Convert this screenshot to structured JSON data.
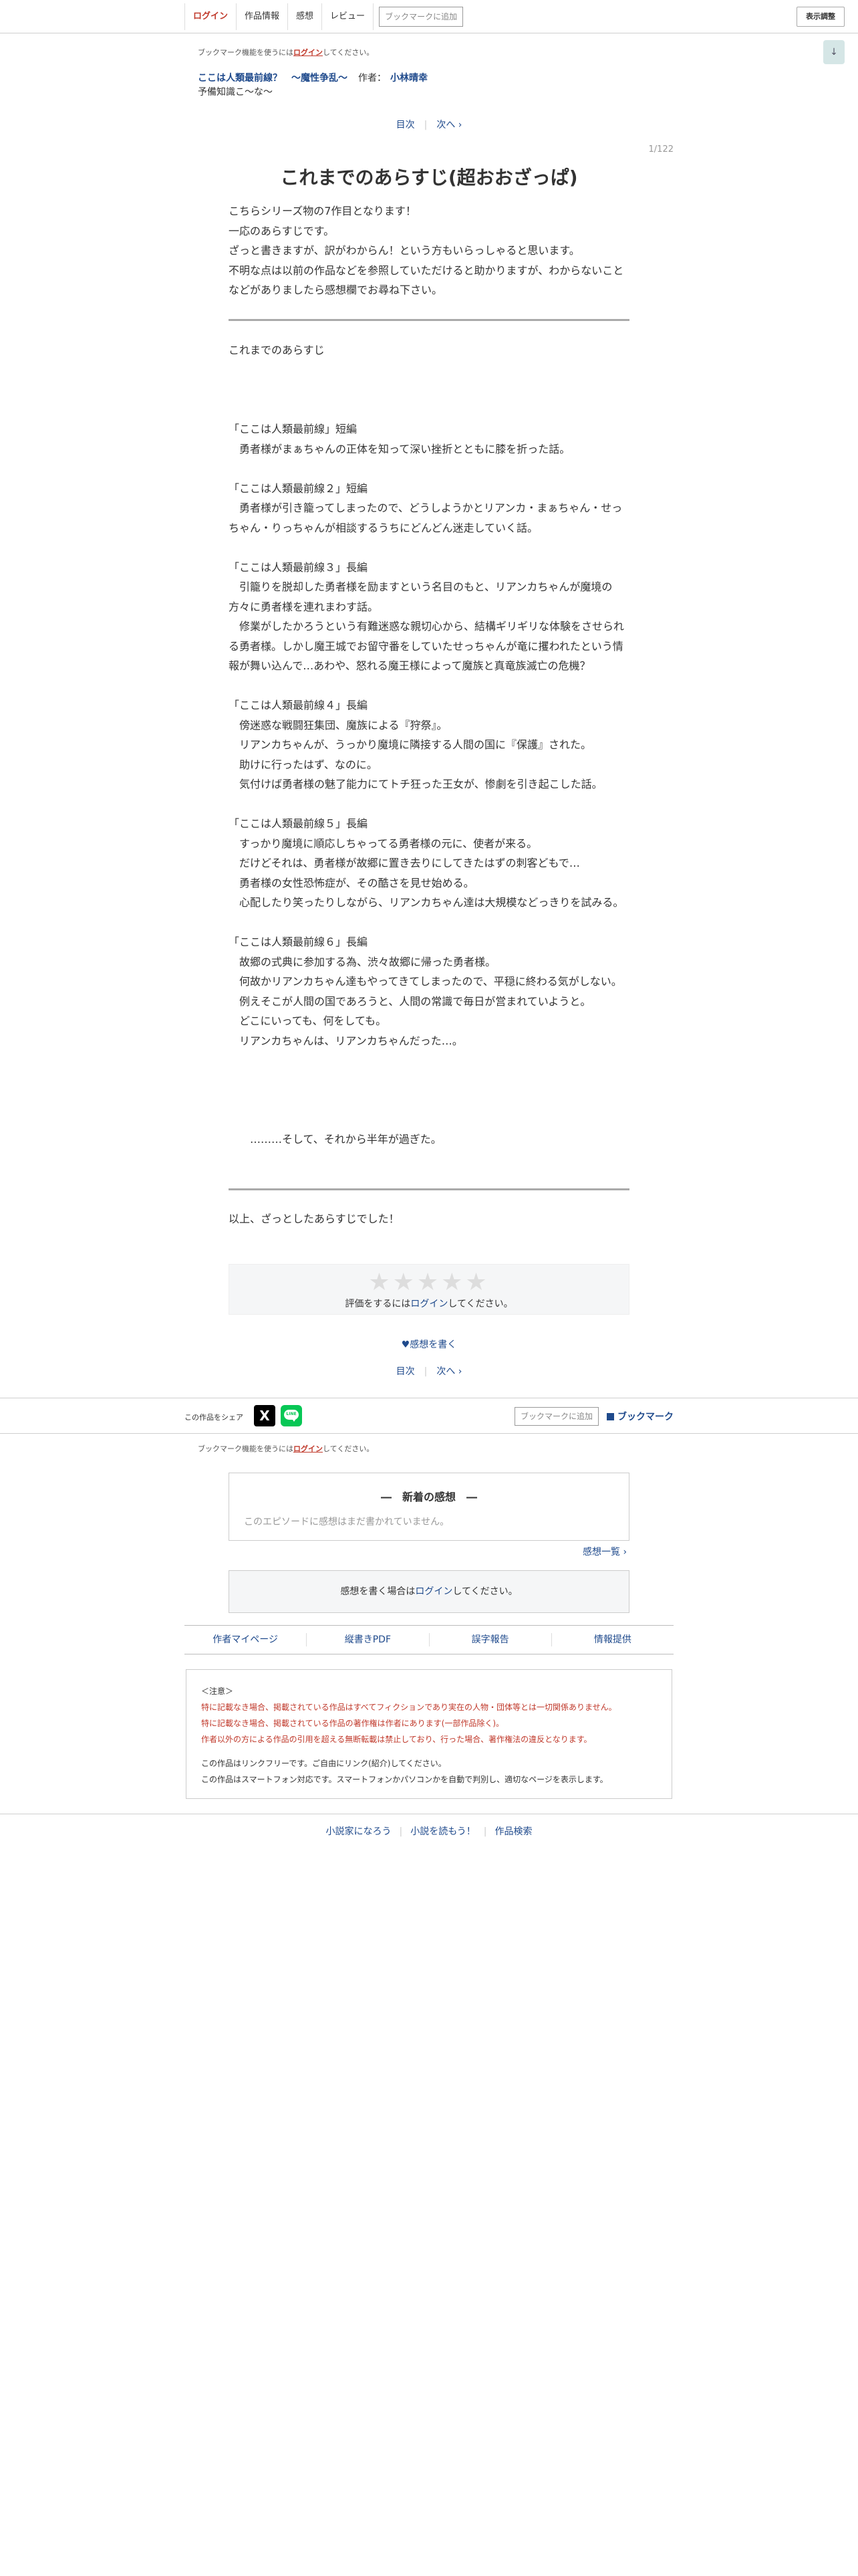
{
  "header": {
    "login": "ログイン",
    "nav": [
      "作品情報",
      "感想",
      "レビュー"
    ],
    "bookmark_add": "ブックマークに追加",
    "display_settings": "表示調整",
    "scroll_icon": "↓"
  },
  "bookmark_note": {
    "prefix": "ブックマーク機能を使うには",
    "login": "ログイン",
    "suffix": "してください。"
  },
  "series": {
    "title": "ここは人類最前線？　～魔性争乱～",
    "author_label": "作者：",
    "author": "小林晴幸",
    "subtitle": "予備知識こ～な～"
  },
  "pager": {
    "toc": "目次",
    "next": "次へ ›"
  },
  "page_counter": "1/122",
  "episode_title": "これまでのあらすじ(超おおざっぱ)",
  "preface": [
    "こちらシリーズ物の7作目となります！",
    "一応のあらすじです。",
    "ざっと書きますが、訳がわからん！という方もいらっしゃると思います。",
    "不明な点は以前の作品などを参照していただけると助かりますが、わからないこと",
    "などがありましたら感想欄でお尋ね下さい。"
  ],
  "body": [
    "これまでのあらすじ",
    "",
    "",
    "",
    "「ここは人類最前線」短編",
    "　勇者様がまぁちゃんの正体を知って深い挫折とともに膝を折った話。",
    "",
    "「ここは人類最前線２」短編",
    "　勇者様が引き籠ってしまったので、どうしようかとリアンカ・まぁちゃん・せっ",
    "ちゃん・りっちゃんが相談するうちにどんどん迷走していく話。",
    "",
    "「ここは人類最前線３」長編",
    "　引籠りを脱却した勇者様を励ますという名目のもと、リアンカちゃんが魔境の",
    "方々に勇者様を連れまわす話。",
    "　修業がしたかろうという有難迷惑な親切心から、結構ギリギリな体験をさせられ",
    "る勇者様。しかし魔王城でお留守番をしていたせっちゃんが竜に攫われたという情",
    "報が舞い込んで…あわや、怒れる魔王様によって魔族と真竜族滅亡の危機？",
    "",
    "「ここは人類最前線４」長編",
    "　傍迷惑な戦闘狂集団、魔族による『狩祭』。",
    "　リアンカちゃんが、うっかり魔境に隣接する人間の国に『保護』された。",
    "　助けに行ったはず、なのに。",
    "　気付けば勇者様の魅了能力にてトチ狂った王女が、惨劇を引き起こした話。",
    "",
    "「ここは人類最前線５」長編",
    "　すっかり魔境に順応しちゃってる勇者様の元に、使者が来る。",
    "　だけどそれは、勇者様が故郷に置き去りにしてきたはずの刺客どもで…",
    "　勇者様の女性恐怖症が、その酷さを見せ始める。",
    "　心配したり笑ったりしながら、リアンカちゃん達は大規模などっきりを試みる。",
    "",
    "「ここは人類最前線６」長編",
    "　故郷の式典に参加する為、渋々故郷に帰った勇者様。",
    "　何故かリアンカちゃん達もやってきてしまったので、平穏に終わる気がしない。",
    "　例えそこが人間の国であろうと、人間の常識で毎日が営まれていようと。",
    "　どこにいっても、何をしても。",
    "　リアンカちゃんは、リアンカちゃんだった…。",
    "",
    "",
    "",
    "",
    "　　………そして、それから半年が過ぎた。"
  ],
  "afterword": "以上、ざっとしたあらすじでした！",
  "rating": {
    "stars": "★★★★★",
    "prefix": "評価をするには",
    "login": "ログイン",
    "suffix": "してください。"
  },
  "write_impression": "♥感想を書く",
  "share": {
    "label": "この作品をシェア",
    "x_icon": "X",
    "line_icon": "LINE",
    "bookmark_add": "ブックマークに追加",
    "bookmark": "ブックマーク"
  },
  "impressions": {
    "title": "―　新着の感想　―",
    "empty": "このエピソードに感想はまだ書かれていません。",
    "list_link": "感想一覧 ›",
    "login_prefix": "感想を書く場合は",
    "login": "ログイン",
    "login_suffix": "してください。"
  },
  "footer_links": [
    "作者マイページ",
    "縦書きPDF",
    "誤字報告",
    "情報提供"
  ],
  "notice": {
    "title": "＜注意＞",
    "red": [
      "特に記載なき場合、掲載されている作品はすべてフィクションであり実在の人物・団体等とは一切関係ありません。",
      "特に記載なき場合、掲載されている作品の著作権は作者にあります(一部作品除く)。",
      "作者以外の方による作品の引用を超える無断転載は禁止しており、行った場合、著作権法の違反となります。"
    ],
    "plain": [
      "この作品はリンクフリーです。ご自由にリンク(紹介)してください。",
      "この作品はスマートフォン対応です。スマートフォンかパソコンかを自動で判別し、適切なページを表示します。"
    ]
  },
  "bottom_links": [
    "小説家になろう",
    "小説を読もう！",
    "作品検索"
  ]
}
